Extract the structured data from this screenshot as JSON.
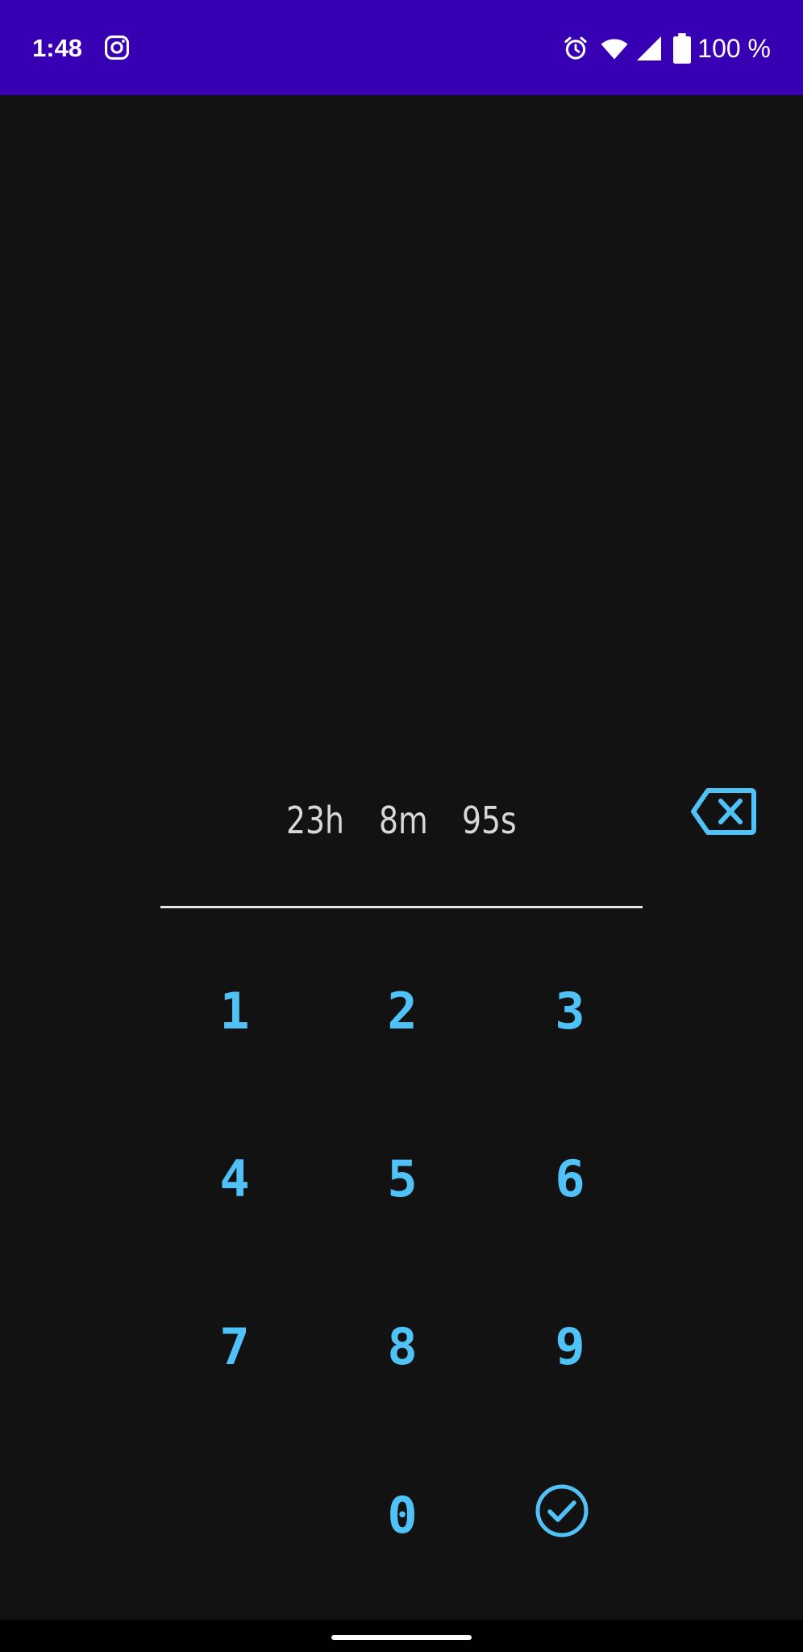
{
  "status_bar": {
    "time": "1:48",
    "notification_icon": "instagram-icon",
    "icons": [
      "alarm-icon",
      "wifi-icon",
      "signal-icon",
      "battery-icon"
    ],
    "battery": "100 %",
    "background": "#3700b3"
  },
  "duration": {
    "hours": "23h",
    "minutes": "8m",
    "seconds": "95s"
  },
  "keypad": {
    "keys": [
      "1",
      "2",
      "3",
      "4",
      "5",
      "6",
      "7",
      "8",
      "9",
      "0"
    ],
    "backspace_icon": "backspace-icon",
    "confirm_icon": "check-circle-icon"
  },
  "colors": {
    "background": "#121212",
    "accent": "#4fc3f7",
    "text": "#d8d8d8"
  }
}
